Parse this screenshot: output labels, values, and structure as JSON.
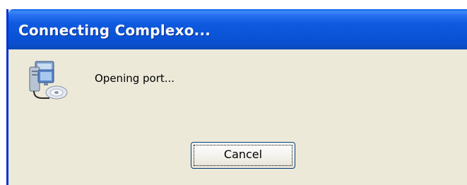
{
  "window": {
    "title": "Connecting Complexo..."
  },
  "dialog": {
    "icon": "network-computer-icon",
    "message": "Opening port...",
    "cancel_label": "Cancel"
  },
  "colors": {
    "titlebar": "#0a53d6",
    "window_border": "#0831d9",
    "dialog_background": "#ece9d8",
    "button_border": "#003c74"
  }
}
